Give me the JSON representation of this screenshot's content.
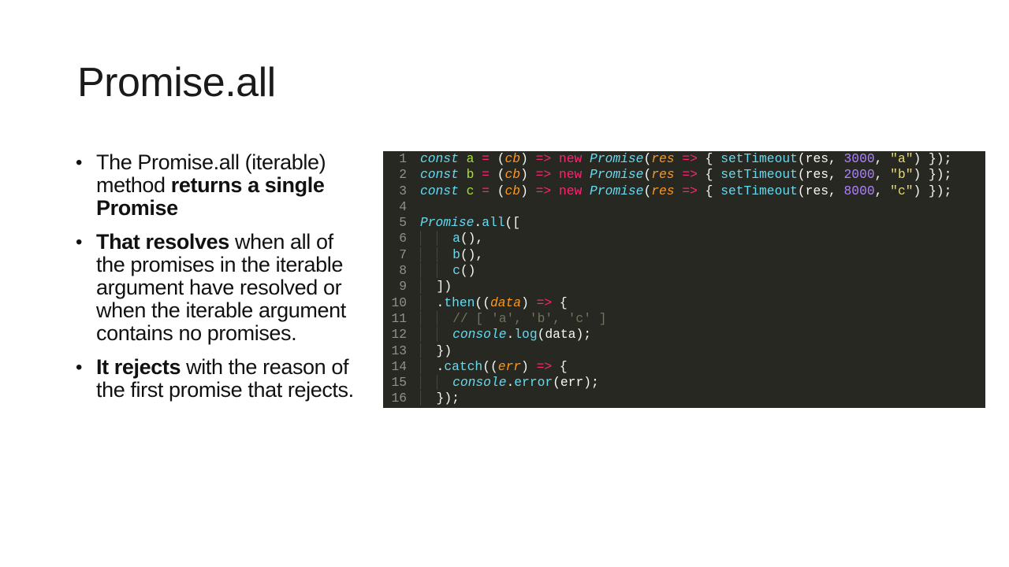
{
  "slide": {
    "title": "Promise.all",
    "bullets": [
      {
        "parts": [
          {
            "text": "The Promise.all (iterable) method ",
            "bold": false
          },
          {
            "text": "returns a single Promise",
            "bold": true
          }
        ]
      },
      {
        "parts": [
          {
            "text": "That resolves",
            "bold": true
          },
          {
            "text": " when all of the promises in the iterable argument have resolved or when the iterable argument contains no promises.",
            "bold": false
          }
        ]
      },
      {
        "parts": [
          {
            "text": "It rejects",
            "bold": true
          },
          {
            "text": " with the reason of the first promise that rejects.",
            "bold": false
          }
        ]
      }
    ]
  },
  "code": {
    "lines": [
      {
        "n": "1",
        "tokens": [
          [
            "kw-it",
            "const"
          ],
          [
            "pl",
            " "
          ],
          [
            "var",
            "a"
          ],
          [
            "pl",
            " "
          ],
          [
            "op",
            "="
          ],
          [
            "pl",
            " ("
          ],
          [
            "param",
            "cb"
          ],
          [
            "pl",
            ") "
          ],
          [
            "op",
            "=>"
          ],
          [
            "pl",
            " "
          ],
          [
            "kw",
            "new"
          ],
          [
            "pl",
            " "
          ],
          [
            "kw-it",
            "Promise"
          ],
          [
            "pl",
            "("
          ],
          [
            "param",
            "res"
          ],
          [
            "pl",
            " "
          ],
          [
            "op",
            "=>"
          ],
          [
            "pl",
            " { "
          ],
          [
            "fn",
            "setTimeout"
          ],
          [
            "pl",
            "(res, "
          ],
          [
            "num",
            "3000"
          ],
          [
            "pl",
            ", "
          ],
          [
            "str",
            "\"a\""
          ],
          [
            "pl",
            ") });"
          ]
        ]
      },
      {
        "n": "2",
        "tokens": [
          [
            "kw-it",
            "const"
          ],
          [
            "pl",
            " "
          ],
          [
            "var",
            "b"
          ],
          [
            "pl",
            " "
          ],
          [
            "op",
            "="
          ],
          [
            "pl",
            " ("
          ],
          [
            "param",
            "cb"
          ],
          [
            "pl",
            ") "
          ],
          [
            "op",
            "=>"
          ],
          [
            "pl",
            " "
          ],
          [
            "kw",
            "new"
          ],
          [
            "pl",
            " "
          ],
          [
            "kw-it",
            "Promise"
          ],
          [
            "pl",
            "("
          ],
          [
            "param",
            "res"
          ],
          [
            "pl",
            " "
          ],
          [
            "op",
            "=>"
          ],
          [
            "pl",
            " { "
          ],
          [
            "fn",
            "setTimeout"
          ],
          [
            "pl",
            "(res, "
          ],
          [
            "num",
            "2000"
          ],
          [
            "pl",
            ", "
          ],
          [
            "str",
            "\"b\""
          ],
          [
            "pl",
            ") });"
          ]
        ]
      },
      {
        "n": "3",
        "tokens": [
          [
            "kw-it",
            "const"
          ],
          [
            "pl",
            " "
          ],
          [
            "var",
            "c"
          ],
          [
            "pl",
            " "
          ],
          [
            "op",
            "="
          ],
          [
            "pl",
            " ("
          ],
          [
            "param",
            "cb"
          ],
          [
            "pl",
            ") "
          ],
          [
            "op",
            "=>"
          ],
          [
            "pl",
            " "
          ],
          [
            "kw",
            "new"
          ],
          [
            "pl",
            " "
          ],
          [
            "kw-it",
            "Promise"
          ],
          [
            "pl",
            "("
          ],
          [
            "param",
            "res"
          ],
          [
            "pl",
            " "
          ],
          [
            "op",
            "=>"
          ],
          [
            "pl",
            " { "
          ],
          [
            "fn",
            "setTimeout"
          ],
          [
            "pl",
            "(res, "
          ],
          [
            "num",
            "8000"
          ],
          [
            "pl",
            ", "
          ],
          [
            "str",
            "\"c\""
          ],
          [
            "pl",
            ") });"
          ]
        ]
      },
      {
        "n": "4",
        "tokens": []
      },
      {
        "n": "5",
        "tokens": [
          [
            "kw-it",
            "Promise"
          ],
          [
            "pl",
            "."
          ],
          [
            "fn",
            "all"
          ],
          [
            "pl",
            "(["
          ]
        ]
      },
      {
        "n": "6",
        "indent": 2,
        "tokens": [
          [
            "fn",
            "a"
          ],
          [
            "pl",
            "(),"
          ]
        ]
      },
      {
        "n": "7",
        "indent": 2,
        "tokens": [
          [
            "fn",
            "b"
          ],
          [
            "pl",
            "(),"
          ]
        ]
      },
      {
        "n": "8",
        "indent": 2,
        "tokens": [
          [
            "fn",
            "c"
          ],
          [
            "pl",
            "()"
          ]
        ]
      },
      {
        "n": "9",
        "indent": 1,
        "tokens": [
          [
            "pl",
            "])"
          ]
        ]
      },
      {
        "n": "10",
        "indent": 1,
        "tokens": [
          [
            "pl",
            "."
          ],
          [
            "fn",
            "then"
          ],
          [
            "pl",
            "(("
          ],
          [
            "param",
            "data"
          ],
          [
            "pl",
            ") "
          ],
          [
            "op",
            "=>"
          ],
          [
            "pl",
            " {"
          ]
        ]
      },
      {
        "n": "11",
        "indent": 2,
        "tokens": [
          [
            "cmt",
            "// [ 'a', 'b', 'c' ]"
          ]
        ]
      },
      {
        "n": "12",
        "indent": 2,
        "tokens": [
          [
            "kw-it",
            "console"
          ],
          [
            "pl",
            "."
          ],
          [
            "fn",
            "log"
          ],
          [
            "pl",
            "(data);"
          ]
        ]
      },
      {
        "n": "13",
        "indent": 1,
        "tokens": [
          [
            "pl",
            "})"
          ]
        ]
      },
      {
        "n": "14",
        "indent": 1,
        "tokens": [
          [
            "pl",
            "."
          ],
          [
            "fn",
            "catch"
          ],
          [
            "pl",
            "(("
          ],
          [
            "param",
            "err"
          ],
          [
            "pl",
            ") "
          ],
          [
            "op",
            "=>"
          ],
          [
            "pl",
            " {"
          ]
        ]
      },
      {
        "n": "15",
        "indent": 2,
        "tokens": [
          [
            "kw-it",
            "console"
          ],
          [
            "pl",
            "."
          ],
          [
            "fn",
            "error"
          ],
          [
            "pl",
            "(err);"
          ]
        ]
      },
      {
        "n": "16",
        "indent": 1,
        "tokens": [
          [
            "pl",
            "});"
          ]
        ]
      }
    ]
  }
}
